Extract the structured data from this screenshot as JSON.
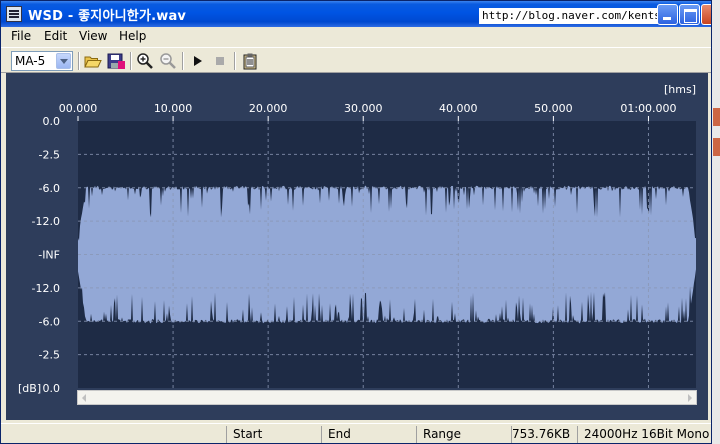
{
  "window": {
    "title": "WSD - 좋지아니한가.wav",
    "overlay_url": "http://blog.naver.com/kentsh2"
  },
  "menu": [
    {
      "label": "File"
    },
    {
      "label": "Edit"
    },
    {
      "label": "View"
    },
    {
      "label": "Help"
    }
  ],
  "toolbar": {
    "preset_value": "MA-5",
    "icons": [
      "open-folder-icon",
      "save-icon",
      "zoom-in-icon",
      "zoom-out-icon",
      "play-icon",
      "stop-icon",
      "clipboard-icon"
    ]
  },
  "chart_data": {
    "type": "area",
    "time_unit_label": "[hms]",
    "x_ticks": [
      "00.000",
      "10.000",
      "20.000",
      "30.000",
      "40.000",
      "50.000",
      "01:00.000"
    ],
    "x_tick_seconds": [
      0,
      10,
      20,
      30,
      40,
      50,
      60
    ],
    "x_range_seconds": [
      0,
      65
    ],
    "y_unit_label": "[dB]",
    "y_ticks": [
      "0.0",
      "-2.5",
      "-6.0",
      "-12.0",
      "-INF",
      "-12.0",
      "-6.0",
      "-2.5",
      "0.0"
    ],
    "envelope_db_typical": -6.0,
    "envelope_db_dips_to": -12.0,
    "grid": true,
    "colors": {
      "background": "#2e3d5b",
      "plot": "#1e2b45",
      "waveform": "#93a8d6",
      "grid": "#8a97b5",
      "text": "#ffffff"
    }
  },
  "status": {
    "start_label": "Start",
    "end_label": "End",
    "range_label": "Range",
    "file_size": "753.76KB",
    "format": "24000Hz 16Bit Mono"
  }
}
